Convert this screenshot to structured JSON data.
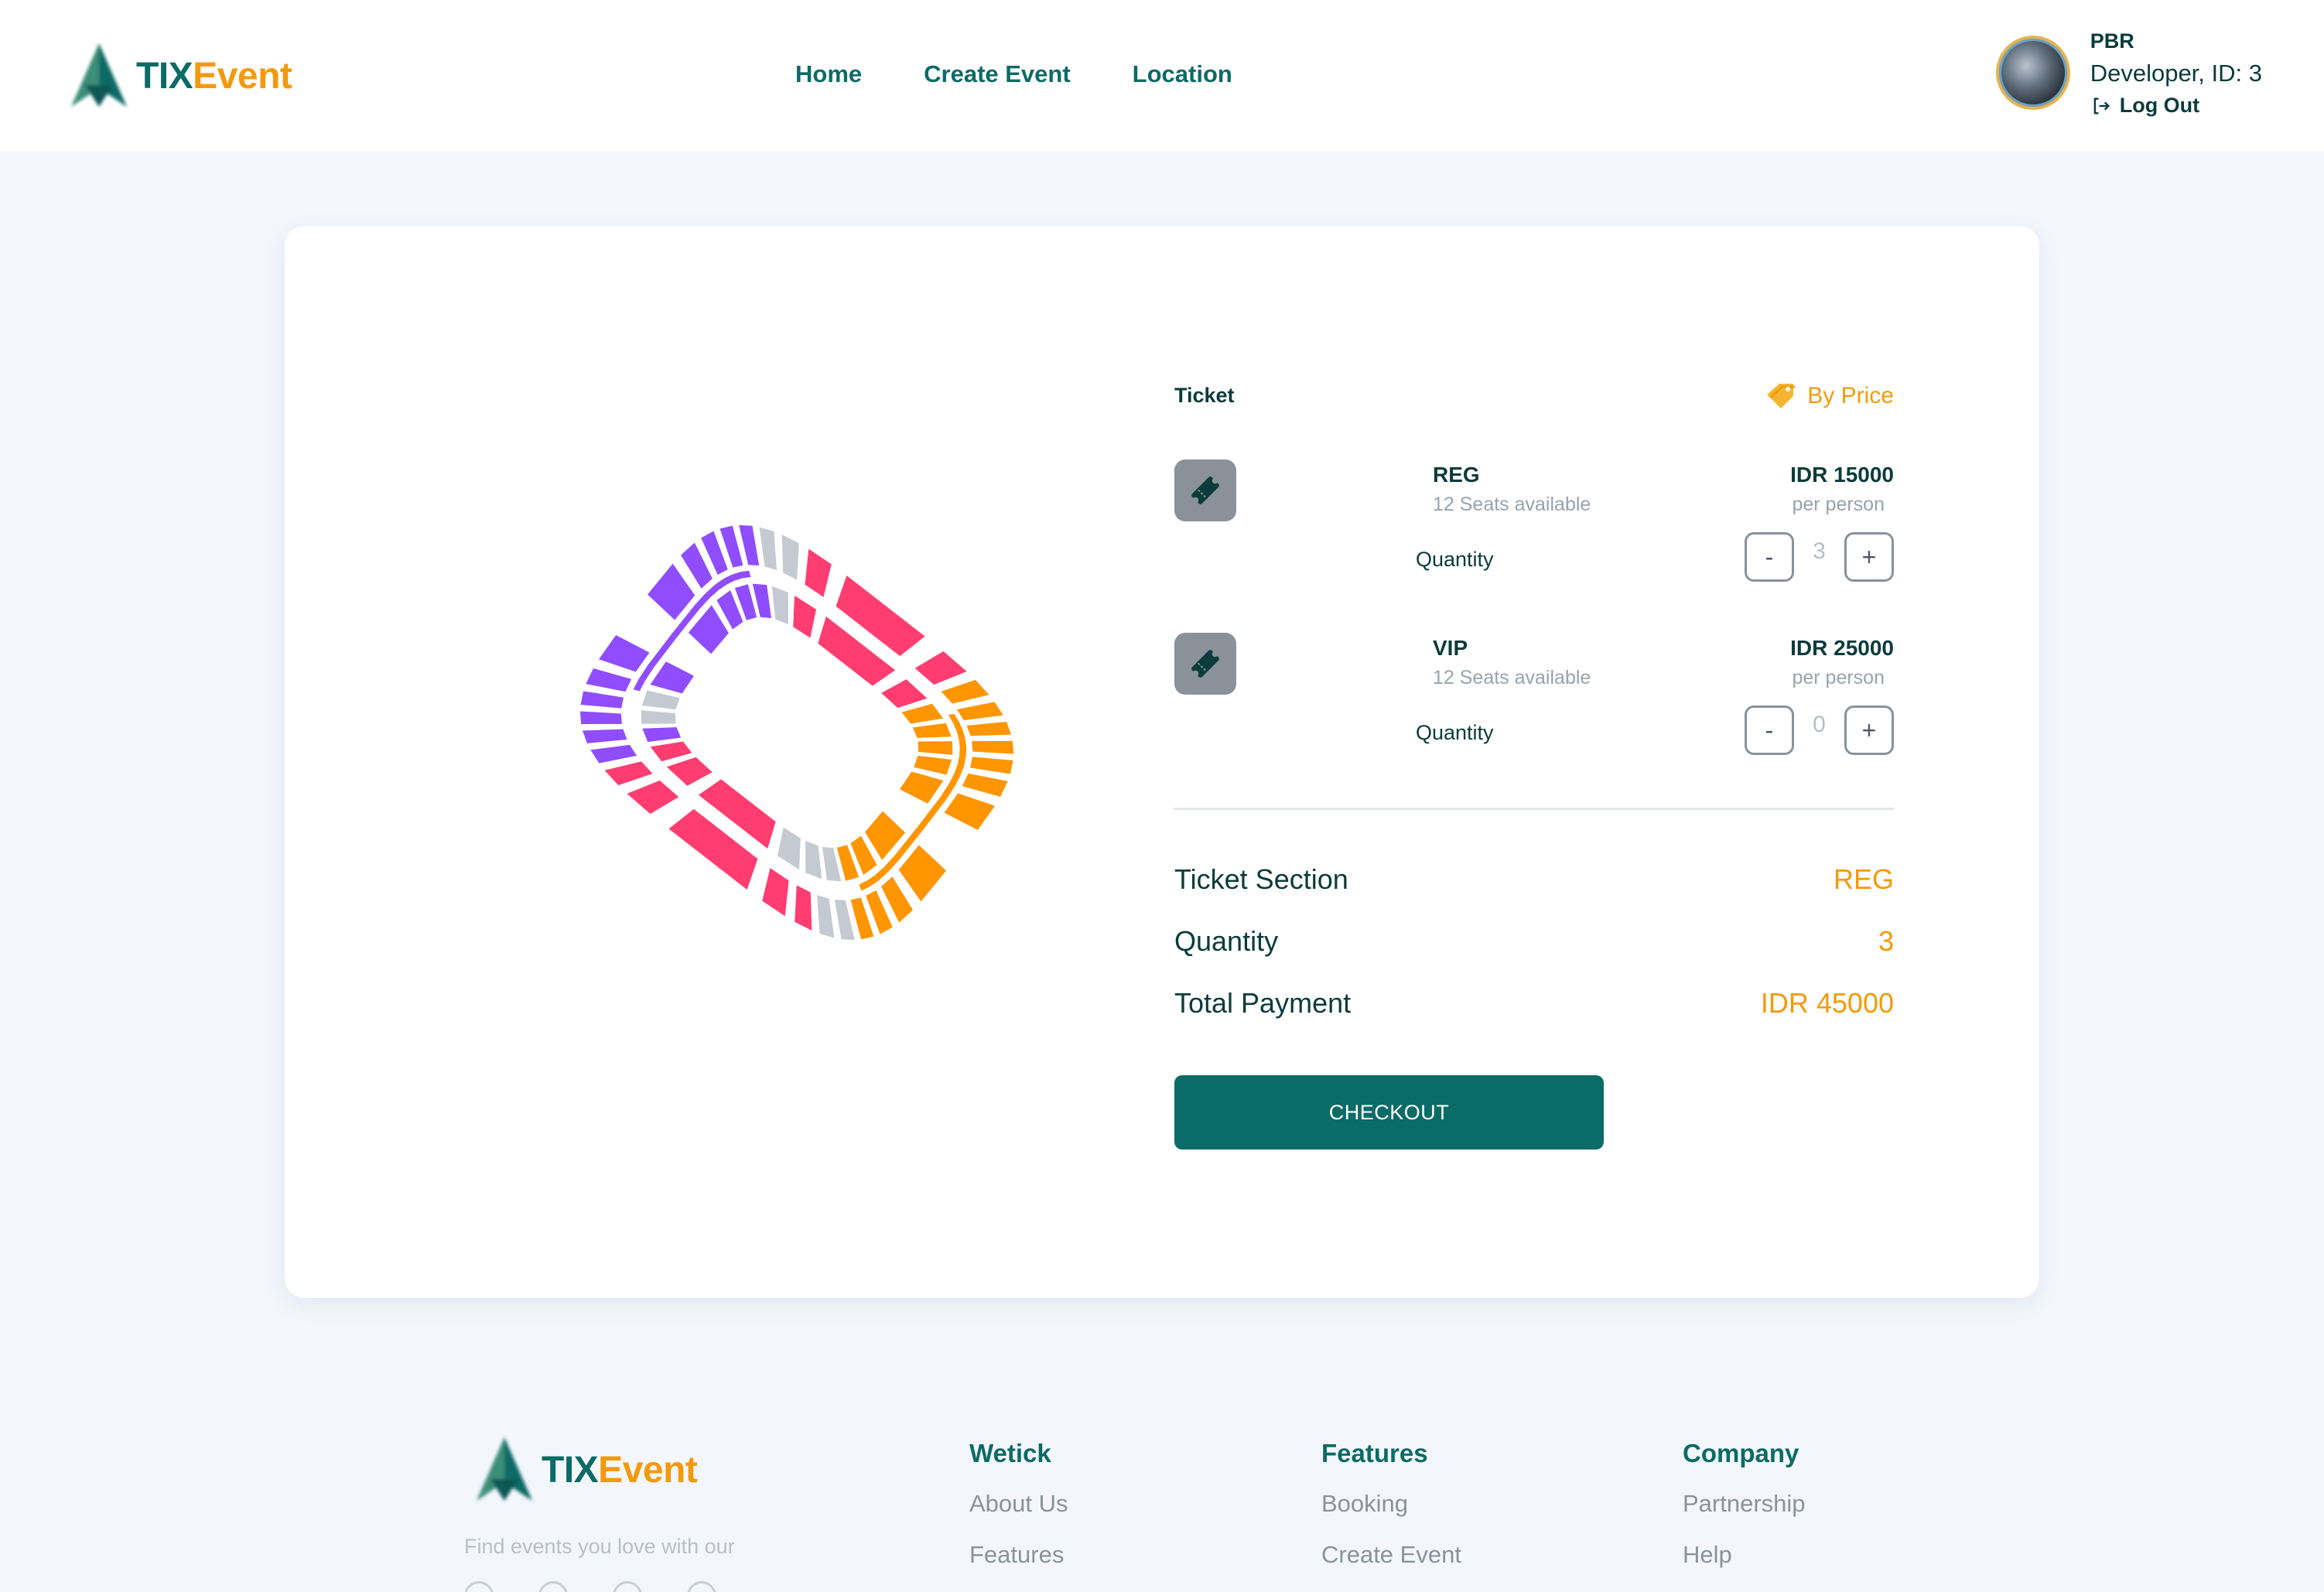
{
  "brand": {
    "part1": "TIX",
    "part2": "Event",
    "color_primary": "#0b6b66",
    "color_accent": "#f39a0c"
  },
  "nav": {
    "items": [
      "Home",
      "Create Event",
      "Location"
    ]
  },
  "user": {
    "name": "PBR",
    "role": "Developer, ID: 3",
    "logout_label": "Log Out"
  },
  "ticket": {
    "header": "Ticket",
    "sort_label": "By Price",
    "tiers": [
      {
        "name": "REG",
        "seats": "12 Seats available",
        "price": "IDR 15000",
        "per": "per person",
        "quantity_label": "Quantity",
        "minus": "-",
        "plus": "+",
        "quantity": "3"
      },
      {
        "name": "VIP",
        "seats": "12 Seats available",
        "price": "IDR 25000",
        "per": "per person",
        "quantity_label": "Quantity",
        "minus": "-",
        "plus": "+",
        "quantity": "0"
      }
    ]
  },
  "summary": {
    "section_label": "Ticket Section",
    "section_value": "REG",
    "quantity_label": "Quantity",
    "quantity_value": "3",
    "total_label": "Total Payment",
    "total_value": "IDR 45000"
  },
  "checkout_label": "CHECKOUT",
  "seat_map": {
    "colors": {
      "orange": "#ff9500",
      "pink": "#ff3d71",
      "purple": "#8f4dff",
      "gray": "#c5c9d2"
    }
  },
  "footer": {
    "tagline": "Find events you love with our",
    "columns": [
      {
        "heading": "Wetick",
        "links": [
          "About Us",
          "Features"
        ]
      },
      {
        "heading": "Features",
        "links": [
          "Booking",
          "Create Event"
        ]
      },
      {
        "heading": "Company",
        "links": [
          "Partnership",
          "Help"
        ]
      }
    ]
  }
}
